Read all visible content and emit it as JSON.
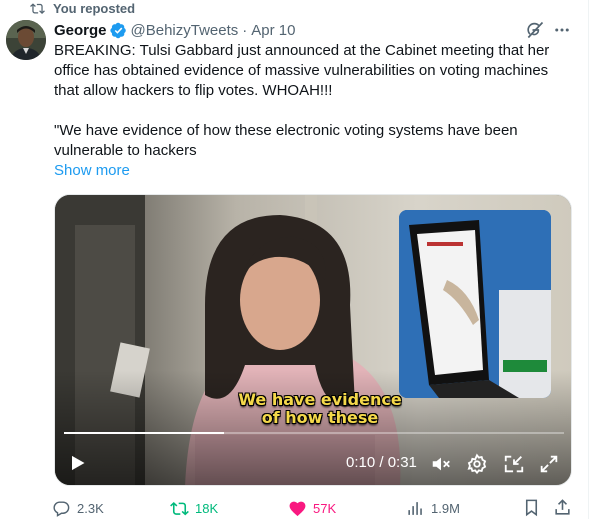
{
  "repost_banner": {
    "text": "You reposted",
    "icon": "repost-icon"
  },
  "author": {
    "display_name": "George",
    "handle": "@BehizyTweets",
    "separator": "·",
    "date": "Apr 10",
    "verified": true
  },
  "tweet": {
    "text": "BREAKING: Tulsi Gabbard just announced at the Cabinet meeting that her office has obtained evidence of massive vulnerabilities on voting machines that allow hackers to flip votes. WHOAH!!!",
    "quote": "\"We have evidence of how these electronic voting systems have been vulnerable to hackers",
    "show_more": "Show more"
  },
  "video": {
    "caption_line1": "We have evidence",
    "caption_line2": "of how these",
    "timecode": "0:10 / 0:31",
    "progress_fraction": 0.32
  },
  "actions": {
    "replies": "2.3K",
    "reposts": "18K",
    "likes": "57K",
    "views": "1.9M"
  },
  "colors": {
    "accent": "#1d9bf0",
    "repost_green": "#00ba7c",
    "like_pink": "#f91880",
    "secondary_text": "#536471",
    "caption_yellow": "#f4d84a"
  }
}
